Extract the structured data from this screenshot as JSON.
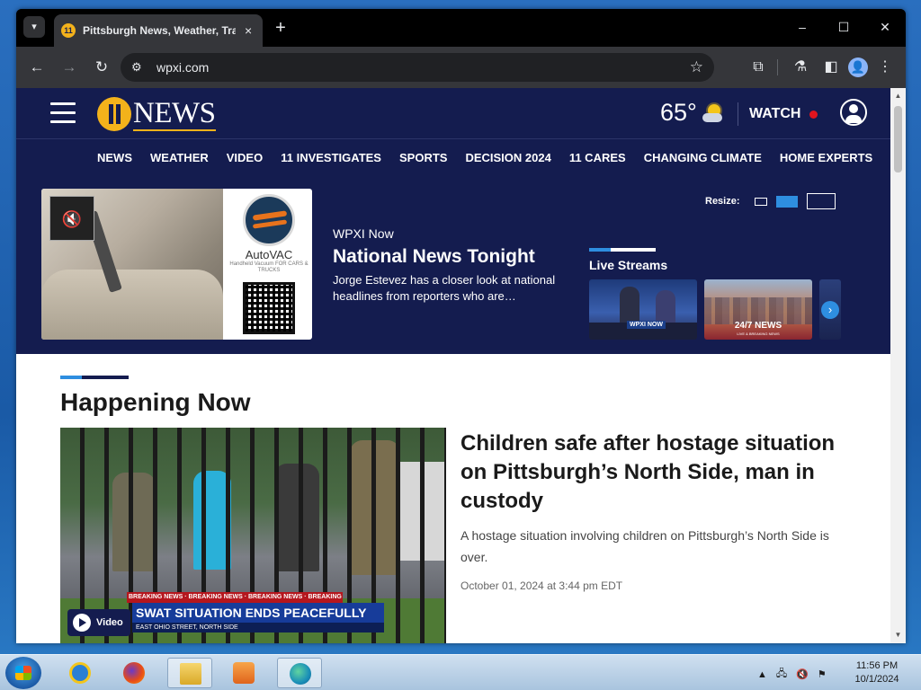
{
  "browser": {
    "tab_menu_icon": "chevron-down-icon",
    "tab_title": "Pittsburgh News, Weather, Traffic",
    "tab_close": "×",
    "new_tab": "+",
    "window_controls": {
      "minimize": "–",
      "maximize": "☐",
      "close": "✕"
    },
    "url": "wpxi.com",
    "back": "←",
    "forward": "→",
    "reload": "↻",
    "star": "☆",
    "extensions": "⧉",
    "labs": "⚗",
    "sidepanel": "◧",
    "menu": "⋮",
    "profile": "●"
  },
  "site": {
    "colors": {
      "navy": "#141c4f",
      "gold": "#f3b21b",
      "accent_blue": "#2e8ee0",
      "live_red": "#e0141e"
    },
    "logo_text": "NEWS",
    "temperature": "65°",
    "weather_icon": "partly-sunny-icon",
    "watch_label": "WATCH",
    "nav": [
      "NEWS",
      "WEATHER",
      "VIDEO",
      "11 INVESTIGATES",
      "SPORTS",
      "DECISION 2024",
      "11 CARES",
      "CHANGING CLIMATE",
      "HOME EXPERTS"
    ],
    "ad": {
      "brand": "AutoVAC",
      "subtitle": "Handheld Vacuum FOR CARS & TRUCKS",
      "mute_icon": "🔇"
    },
    "feature": {
      "kicker": "WPXI Now",
      "title": "National News Tonight",
      "description": "Jorge Estevez has a closer look at national headlines from reporters who are…"
    },
    "resize_label": "Resize:",
    "live_streams": {
      "title": "Live Streams",
      "thumb1_brand": "WPXI NOW",
      "thumb2_label": "24/7 NEWS",
      "thumb2_sublabel": "LIVE & BREAKING NEWS",
      "next": "›"
    },
    "section_title": "Happening Now",
    "lead_story": {
      "ticker": "BREAKING NEWS · BREAKING NEWS · BREAKING NEWS · BREAKING NEWS · BREAK",
      "lower_third_headline": "SWAT SITUATION ENDS PEACEFULLY",
      "lower_third_location": "EAST OHIO STREET, NORTH SIDE",
      "video_label": "Video",
      "headline": "Children safe after hostage situation on Pittsburgh’s North Side, man in custody",
      "summary": "A hostage situation involving children on Pittsburgh’s North Side is over.",
      "date": "October 01, 2024 at 3:44 pm EDT"
    }
  },
  "taskbar": {
    "apps": [
      "internet-explorer-icon",
      "firefox-icon",
      "file-explorer-icon",
      "media-player-icon",
      "edge-icon"
    ],
    "tray_arrow": "▲",
    "time": "11:56 PM",
    "date": "10/1/2024"
  }
}
